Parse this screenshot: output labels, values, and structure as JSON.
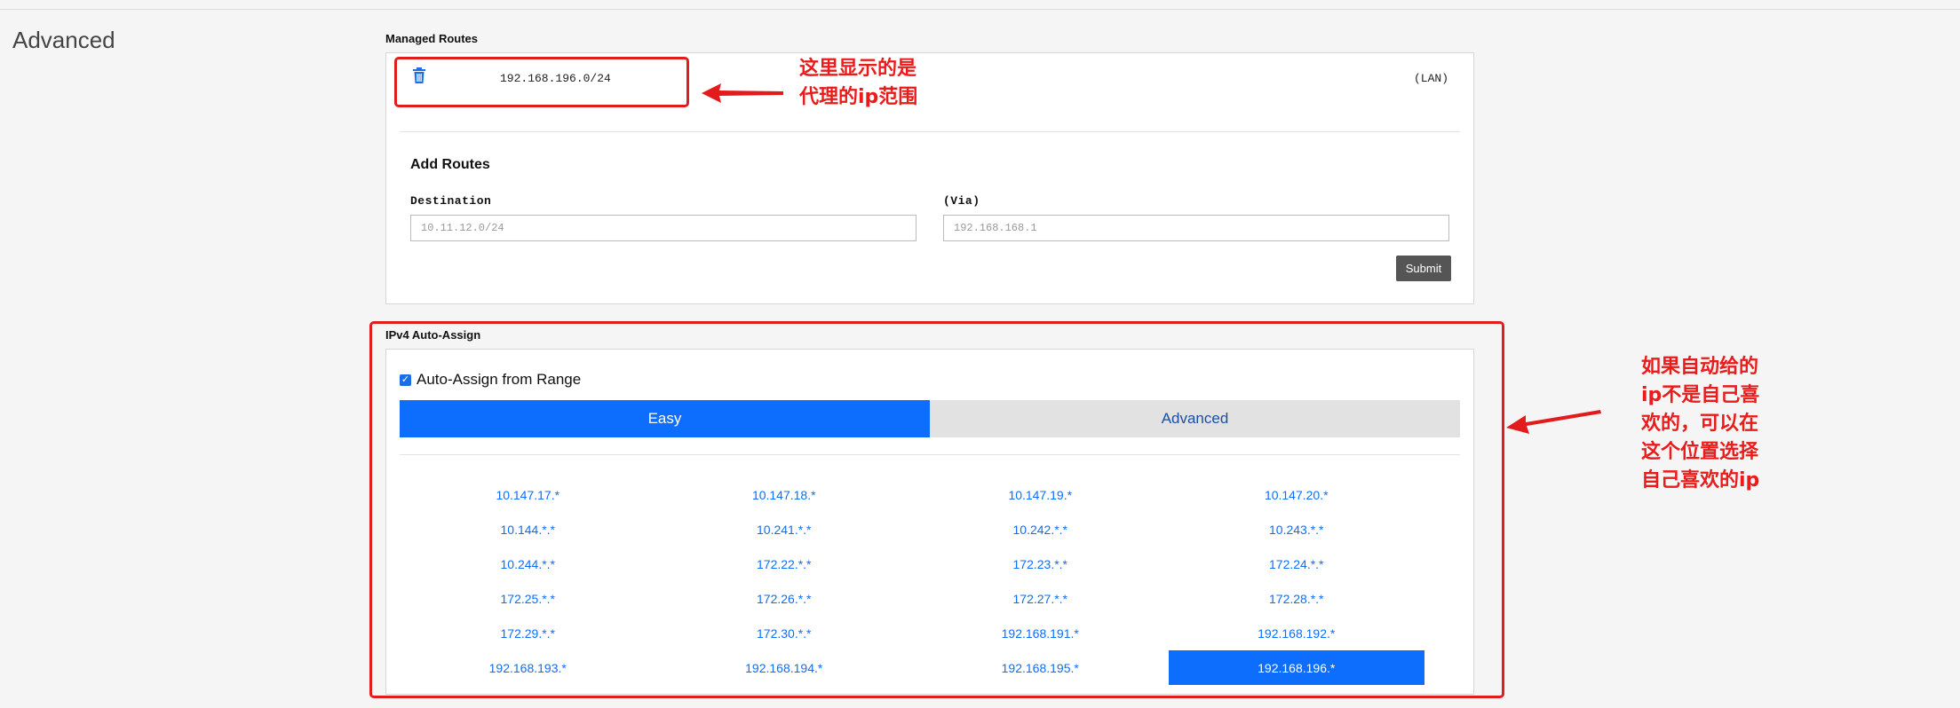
{
  "section": {
    "title": "Advanced"
  },
  "managed_routes": {
    "heading": "Managed Routes",
    "routes": [
      {
        "destination": "192.168.196.0/24",
        "type": "(LAN)"
      }
    ]
  },
  "add_routes": {
    "title": "Add Routes",
    "destination_label": "Destination",
    "destination_placeholder": "10.11.12.0/24",
    "via_label": "(Via)",
    "via_placeholder": "192.168.168.1",
    "submit_label": "Submit"
  },
  "auto_assign": {
    "heading": "IPv4 Auto-Assign",
    "checkbox_label": "Auto-Assign from Range",
    "checked": true,
    "tabs": [
      {
        "label": "Easy",
        "active": true
      },
      {
        "label": "Advanced",
        "active": false
      }
    ],
    "ranges": [
      {
        "label": "10.147.17.*",
        "selected": false
      },
      {
        "label": "10.147.18.*",
        "selected": false
      },
      {
        "label": "10.147.19.*",
        "selected": false
      },
      {
        "label": "10.147.20.*",
        "selected": false
      },
      {
        "label": "10.144.*.*",
        "selected": false
      },
      {
        "label": "10.241.*.*",
        "selected": false
      },
      {
        "label": "10.242.*.*",
        "selected": false
      },
      {
        "label": "10.243.*.*",
        "selected": false
      },
      {
        "label": "10.244.*.*",
        "selected": false
      },
      {
        "label": "172.22.*.*",
        "selected": false
      },
      {
        "label": "172.23.*.*",
        "selected": false
      },
      {
        "label": "172.24.*.*",
        "selected": false
      },
      {
        "label": "172.25.*.*",
        "selected": false
      },
      {
        "label": "172.26.*.*",
        "selected": false
      },
      {
        "label": "172.27.*.*",
        "selected": false
      },
      {
        "label": "172.28.*.*",
        "selected": false
      },
      {
        "label": "172.29.*.*",
        "selected": false
      },
      {
        "label": "172.30.*.*",
        "selected": false
      },
      {
        "label": "192.168.191.*",
        "selected": false
      },
      {
        "label": "192.168.192.*",
        "selected": false
      },
      {
        "label": "192.168.193.*",
        "selected": false
      },
      {
        "label": "192.168.194.*",
        "selected": false
      },
      {
        "label": "192.168.195.*",
        "selected": false
      },
      {
        "label": "192.168.196.*",
        "selected": true
      }
    ]
  },
  "annotations": {
    "note1_lines": [
      "这里显示的是",
      "代理的ip范围"
    ],
    "note2_lines": [
      "如果自动给的",
      "ip不是自己喜",
      "欢的，可以在",
      "这个位置选择",
      "自己喜欢的ip"
    ]
  },
  "colors": {
    "accent": "#0d6efd",
    "annotation": "#e21c1c",
    "submit": "#555555"
  },
  "icons": {
    "delete": "trash-icon",
    "checkbox": "checkmark-icon"
  }
}
